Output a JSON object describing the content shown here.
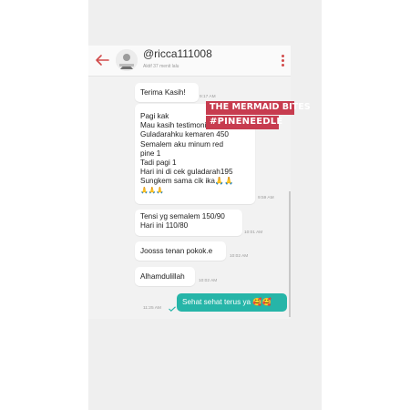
{
  "header": {
    "username": "@ricca111008",
    "status": "Aktif 37 menit lalu"
  },
  "stickers": {
    "line1": "THE MERMAID BITES",
    "line2": "#PINENEEDLE"
  },
  "messages": [
    {
      "id": "m1",
      "lines": [
        "Terima Kasih!"
      ],
      "time": "9:17 AM"
    },
    {
      "id": "m2",
      "lines": [
        "Pagi kak",
        "Mau kasih testimoni",
        "Guladarahku kemaren 450",
        "Semalem aku minum red",
        "pine 1",
        "Tadi pagi 1",
        "Hari ini di cek guladarah195",
        "Sungkem sama cik ika🙏🙏",
        "🙏🙏🙏"
      ],
      "time": "9:59 AM"
    },
    {
      "id": "m3",
      "lines": [
        "Tensi yg semalem 150/90",
        "Hari ini 110/80"
      ],
      "time": "10:01 AM"
    },
    {
      "id": "m4",
      "lines": [
        "Joosss tenan pokok.e"
      ],
      "time": "10:02 AM"
    },
    {
      "id": "m5",
      "lines": [
        "Alhamdulillah"
      ],
      "time": "10:02 AM"
    }
  ],
  "sent": {
    "text": "Sehat sehat terus ya 🥰🥰",
    "time": "11:25 AM"
  },
  "colors": {
    "accent": "#d14b4b",
    "sent_bubble": "#26b5a8",
    "sticker": "#c73c4f"
  },
  "icons": [
    "back-arrow-icon",
    "avatar",
    "more-vert-icon",
    "read-check-icon"
  ]
}
